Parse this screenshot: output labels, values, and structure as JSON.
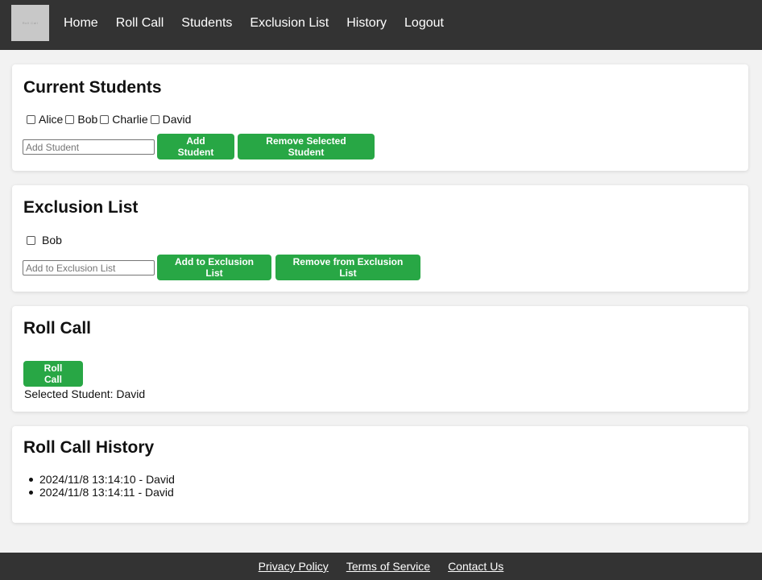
{
  "nav": {
    "logo_text": "Roll Call",
    "items": [
      "Home",
      "Roll Call",
      "Students",
      "Exclusion List",
      "History",
      "Logout"
    ]
  },
  "current_students": {
    "title": "Current Students",
    "students": [
      "Alice",
      "Bob",
      "Charlie",
      "David"
    ],
    "input_placeholder": "Add Student",
    "add_label": "Add Student",
    "remove_label": "Remove Selected Student"
  },
  "exclusion": {
    "title": "Exclusion List",
    "items": [
      "Bob"
    ],
    "input_placeholder": "Add to Exclusion List",
    "add_label": "Add to Exclusion List",
    "remove_label": "Remove from Exclusion List"
  },
  "roll_call": {
    "title": "Roll Call",
    "button_label": "Roll Call",
    "selected_text": "Selected Student: David"
  },
  "history": {
    "title": "Roll Call History",
    "entries": [
      "2024/11/8 13:14:10 - David",
      "2024/11/8 13:14:11 - David"
    ]
  },
  "footer": {
    "links": [
      "Privacy Policy",
      "Terms of Service",
      "Contact Us"
    ]
  },
  "colors": {
    "header_bg": "#333333",
    "button_green": "#28a745",
    "page_bg": "#f2f2f2"
  }
}
